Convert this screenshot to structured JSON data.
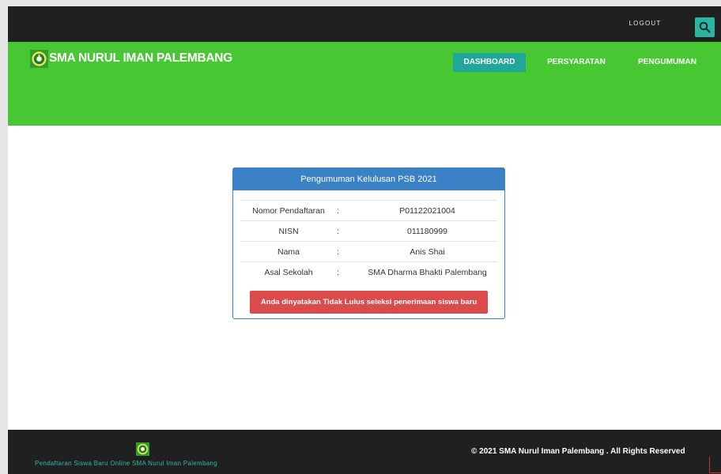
{
  "topbar": {
    "logout_label": "LOGOUT",
    "search_icon": "search-icon"
  },
  "header": {
    "logo_icon": "school-emblem-icon",
    "site_title": "SMA NURUL IMAN PALEMBANG",
    "nav": {
      "dashboard": "DASHBOARD",
      "persyaratan": "PERSYARATAN",
      "pengumuman": "PENGUMUMAN"
    }
  },
  "announcement": {
    "title": "Pengumuman Kelulusan PSB 2021",
    "rows": [
      {
        "label": "Nomor Pendaftaran",
        "sep": ":",
        "value": "P01122021004"
      },
      {
        "label": "NISN",
        "sep": ":",
        "value": "011180999"
      },
      {
        "label": "Nama",
        "sep": ":",
        "value": "Anis Shai"
      },
      {
        "label": "Asal Sekolah",
        "sep": ":",
        "value": "SMA Dharma Bhakti Palembang"
      }
    ],
    "result_message": "Anda dinyatakan Tidak Lulus seleksi penerimaan siswa baru"
  },
  "footer": {
    "tagline": "Pendaftaran Siswa Baru Online SMA Nurul Iman Palembang",
    "copyright": "© 2021 SMA Nurul Iman Palembang . All Rights Reserved"
  },
  "colors": {
    "topbar": "#202020",
    "header_green": "#47c732",
    "nav_active": "#21a69c",
    "panel_blue": "#3a81c5",
    "alert_red": "#dc4b4b",
    "accent_teal": "#2ab5a0"
  }
}
